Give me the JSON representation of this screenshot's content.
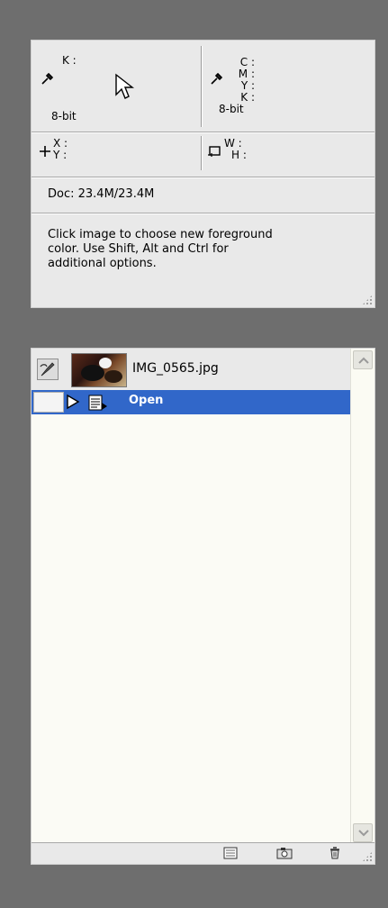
{
  "info": {
    "k_label": "K :",
    "c_label": "C :",
    "m_label": "M :",
    "y_label": "Y :",
    "k2_label": "K :",
    "bitdepth_left": "8-bit",
    "bitdepth_right": "8-bit",
    "x_label": "X :",
    "y_coord_label": "Y :",
    "w_label": "W :",
    "h_label": "H :",
    "doc_size": "Doc: 23.4M/23.4M",
    "help_text_line1": "Click image to choose new foreground",
    "help_text_line2": "color.  Use Shift, Alt and Ctrl for",
    "help_text_line3": "additional options."
  },
  "history": {
    "snapshot_name": "IMG_0565.jpg",
    "states": [
      {
        "label": "Open",
        "selected": true
      }
    ],
    "footer_buttons": [
      "new-document-icon",
      "camera-icon",
      "trash-icon"
    ]
  },
  "colors": {
    "background": "#6e6e6e",
    "panel": "#e9e9e9",
    "selection": "#3167c9"
  }
}
